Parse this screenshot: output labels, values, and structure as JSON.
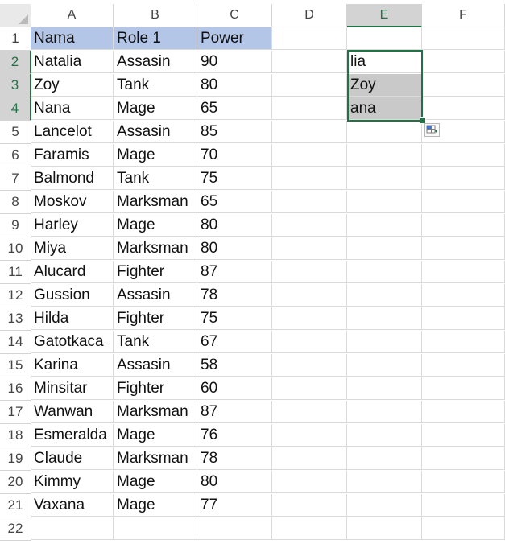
{
  "columns": [
    "A",
    "B",
    "C",
    "D",
    "E",
    "F"
  ],
  "active_column": "E",
  "rows": [
    "1",
    "2",
    "3",
    "4",
    "5",
    "6",
    "7",
    "8",
    "9",
    "10",
    "11",
    "12",
    "13",
    "14",
    "15",
    "16",
    "17",
    "18",
    "19",
    "20",
    "21",
    "22"
  ],
  "headers": [
    "Nama",
    "Role 1",
    "Power"
  ],
  "records": [
    [
      "Natalia",
      "Assasin",
      "90"
    ],
    [
      "Zoy",
      "Tank",
      "80"
    ],
    [
      "Nana",
      "Mage",
      "65"
    ],
    [
      "Lancelot",
      "Assasin",
      "85"
    ],
    [
      "Faramis",
      "Mage",
      "70"
    ],
    [
      "Balmond",
      "Tank",
      "75"
    ],
    [
      "Moskov",
      "Marksman",
      "65"
    ],
    [
      "Harley",
      "Mage",
      "80"
    ],
    [
      "Miya",
      "Marksman",
      "80"
    ],
    [
      "Alucard",
      "Fighter",
      "87"
    ],
    [
      "Gussion",
      "Assasin",
      "78"
    ],
    [
      "Hilda",
      "Fighter",
      "75"
    ],
    [
      "Gatotkaca",
      "Tank",
      "67"
    ],
    [
      "Karina",
      "Assasin",
      "58"
    ],
    [
      "Minsitar",
      "Fighter",
      "60"
    ],
    [
      "Wanwan",
      "Marksman",
      "87"
    ],
    [
      "Esmeralda",
      "Mage",
      "76"
    ],
    [
      "Claude",
      "Marksman",
      "78"
    ],
    [
      "Kimmy",
      "Mage",
      "80"
    ],
    [
      "Vaxana",
      "Mage",
      "77"
    ]
  ],
  "column_e": [
    "lia",
    "Zoy",
    "ana"
  ],
  "colors": {
    "header_fill": "#b4c6e7",
    "selection_border": "#217346",
    "flash_fill_gray": "#c9c9c9"
  },
  "icons": {
    "flash_fill_options": "flash-fill-options-icon"
  }
}
